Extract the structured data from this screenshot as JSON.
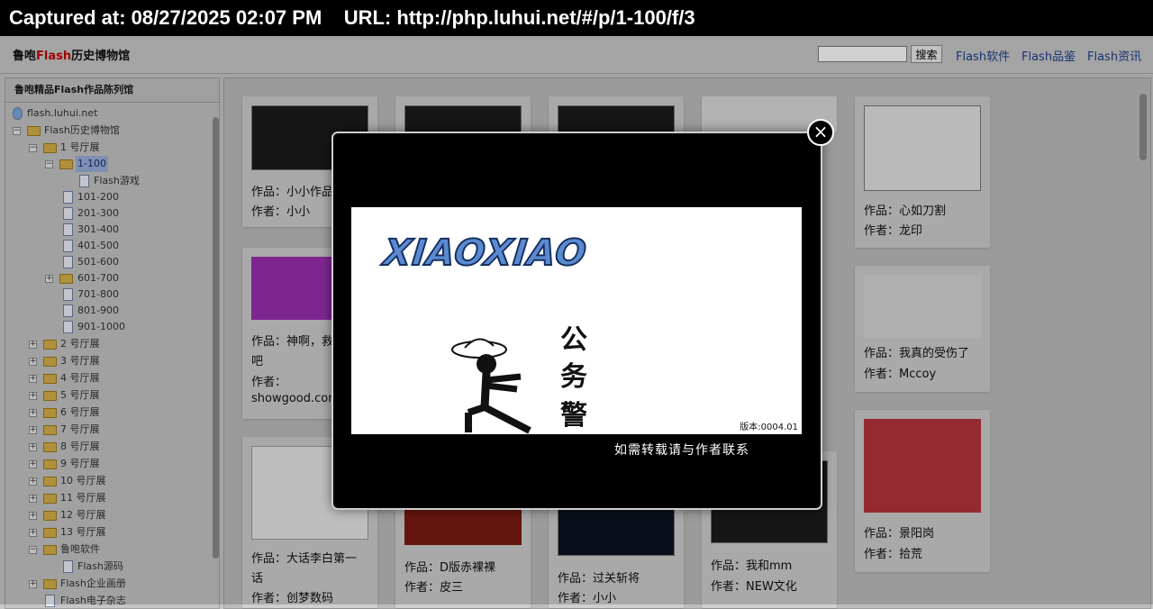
{
  "capture": {
    "text": "Captured at: 08/27/2025 02:07 PM    URL: http://php.luhui.net/#/p/1-100/f/3"
  },
  "header": {
    "title_prefix": "鲁咆",
    "title_brand": "Flash",
    "title_suffix": "历史博物馆",
    "search_value": "",
    "search_button": "搜索",
    "nav": [
      "Flash软件",
      "Flash品鉴",
      "Flash资讯"
    ]
  },
  "sidebar": {
    "title": "鲁咆精品Flash作品陈列馆",
    "root": "flash.luhui.net",
    "museum": "Flash历史博物馆",
    "hall1": "1 号厅展",
    "selected": "1-100",
    "game": "Flash游戏",
    "ranges": [
      "101-200",
      "201-300",
      "301-400",
      "401-500",
      "501-600",
      "601-700",
      "701-800",
      "801-900",
      "901-1000"
    ],
    "halls": [
      "2 号厅展",
      "3 号厅展",
      "4 号厅展",
      "5 号厅展",
      "6 号厅展",
      "7 号厅展",
      "8 号厅展",
      "9 号厅展",
      "10 号厅展",
      "11 号厅展",
      "12 号厅展",
      "13 号厅展"
    ],
    "software": "鲁咆软件",
    "source": "Flash源码",
    "enterprise": "Flash企业画册",
    "ebook": "Flash电子杂志"
  },
  "cards": [
    {
      "work": "作品：小小作品",
      "author": "作者：小小"
    },
    {
      "work": "作品：心如刀割",
      "author": "作者：龙印"
    },
    {
      "work": "作品：神啊，救",
      "work2": "吧",
      "author": "作者：",
      "author2": "showgood.com"
    },
    {
      "work": "作品：我真的受伤了",
      "author": "作者：Mccoy"
    },
    {
      "work": "作品：大话李白第一",
      "work2": "话",
      "author": "作者：创梦数码"
    },
    {
      "work": "作品：D版赤裸裸",
      "author": "作者：皮三"
    },
    {
      "work": "作品：过关斩将",
      "author": "作者：小小"
    },
    {
      "work": "作品：我和mm",
      "author": "作者：NEW文化"
    },
    {
      "work": "作品：景阳岗",
      "author": "作者：拾荒"
    }
  ],
  "modal": {
    "logo": "XIAOXIAO",
    "chars": [
      "公",
      "务",
      "警"
    ],
    "version": "版本:0004.01",
    "caption": "如需转载请与作者联系",
    "close": "×"
  }
}
